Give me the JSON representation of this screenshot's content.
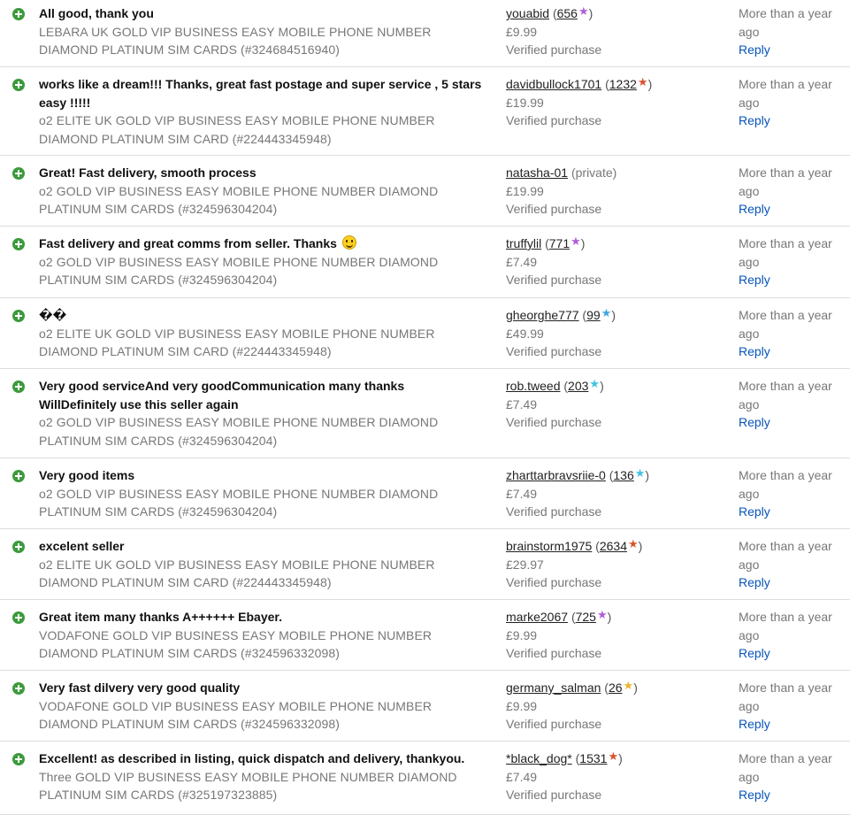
{
  "rows": [
    {
      "comment": "All good, thank you",
      "item_line1": "LEBARA UK GOLD VIP BUSINESS EASY MOBILE PHONE NUMBER",
      "item_line2": "DIAMOND PLATINUM SIM CARDS (#324684516940)",
      "user": "youabid",
      "score": "656",
      "star_color": "#b05cd6",
      "price": "£9.99",
      "verified": "Verified purchase",
      "when": "More than a year ago",
      "reply": "Reply"
    },
    {
      "comment_line1": "works like a dream!!! Thanks, great fast postage and super service , 5 stars",
      "comment_line2": "easy !!!!!",
      "item_line1": "o2 ELITE UK GOLD VIP BUSINESS EASY MOBILE PHONE NUMBER",
      "item_line2": "DIAMOND PLATINUM SIM CARD (#224443345948)",
      "user": "davidbullock1701",
      "score": "1232",
      "star_color": "#d9532c",
      "price": "£19.99",
      "verified": "Verified purchase",
      "when": "More than a year ago",
      "reply": "Reply"
    },
    {
      "comment": "Great! Fast delivery, smooth process",
      "item_line1": "o2 GOLD VIP BUSINESS EASY MOBILE PHONE NUMBER DIAMOND",
      "item_line2": "PLATINUM SIM CARDS (#324596304204)",
      "user": "natasha-01",
      "private": "(private)",
      "price": "£19.99",
      "verified": "Verified purchase",
      "when": "More than a year ago",
      "reply": "Reply"
    },
    {
      "comment": "Fast delivery and great comms from seller. Thanks",
      "item_line1": "o2 GOLD VIP BUSINESS EASY MOBILE PHONE NUMBER DIAMOND",
      "item_line2": "PLATINUM SIM CARDS (#324596304204)",
      "user": "truffylil",
      "score": "771",
      "star_color": "#b05cd6",
      "price": "£7.49",
      "verified": "Verified purchase",
      "when": "More than a year ago",
      "reply": "Reply"
    },
    {
      "comment": "��",
      "item_line1": "o2 ELITE UK GOLD VIP BUSINESS EASY MOBILE PHONE NUMBER",
      "item_line2": "DIAMOND PLATINUM SIM CARD (#224443345948)",
      "user": "gheorghe777",
      "score": "99",
      "star_color": "#3ea6e0",
      "price": "£49.99",
      "verified": "Verified purchase",
      "when": "More than a year ago",
      "reply": "Reply"
    },
    {
      "comment_line1": "Very good serviceAnd very goodCommunication many thanks",
      "comment_line2": "WillDefinitely use this seller again",
      "item_line1": "o2 GOLD VIP BUSINESS EASY MOBILE PHONE NUMBER DIAMOND",
      "item_line2": "PLATINUM SIM CARDS (#324596304204)",
      "user": "rob.tweed",
      "score": "203",
      "star_color": "#3ec3e0",
      "price": "£7.49",
      "verified": "Verified purchase",
      "when": "More than a year ago",
      "reply": "Reply"
    },
    {
      "comment": "Very good items",
      "item_line1": "o2 GOLD VIP BUSINESS EASY MOBILE PHONE NUMBER DIAMOND",
      "item_line2": "PLATINUM SIM CARDS (#324596304204)",
      "user": "zharttarbravsriie-0",
      "score": "136",
      "star_color": "#3ec3e0",
      "price": "£7.49",
      "verified": "Verified purchase",
      "when": "More than a year ago",
      "reply": "Reply"
    },
    {
      "comment": "excelent seller",
      "item_line1": "o2 ELITE UK GOLD VIP BUSINESS EASY MOBILE PHONE NUMBER",
      "item_line2": "DIAMOND PLATINUM SIM CARD (#224443345948)",
      "user": "brainstorm1975",
      "score": "2634",
      "star_color": "#d9532c",
      "price": "£29.97",
      "verified": "Verified purchase",
      "when": "More than a year ago",
      "reply": "Reply"
    },
    {
      "comment": "Great item many thanks A++++++ Ebayer.",
      "item_line1": "VODAFONE GOLD VIP BUSINESS EASY MOBILE PHONE NUMBER",
      "item_line2": "DIAMOND PLATINUM SIM CARDS (#324596332098)",
      "user": "marke2067",
      "score": "725",
      "star_color": "#b05cd6",
      "price": "£9.99",
      "verified": "Verified purchase",
      "when": "More than a year ago",
      "reply": "Reply"
    },
    {
      "comment": "Very fast dilvery very good quality",
      "item_line1": "VODAFONE GOLD VIP BUSINESS EASY MOBILE PHONE NUMBER",
      "item_line2": "DIAMOND PLATINUM SIM CARDS (#324596332098)",
      "user": "germany_salman",
      "score": "26",
      "star_color": "#e8b72c",
      "price": "£9.99",
      "verified": "Verified purchase",
      "when": "More than a year ago",
      "reply": "Reply"
    },
    {
      "comment": "Excellent! as described in listing, quick dispatch and delivery, thankyou.",
      "item_line1": "Three GOLD VIP BUSINESS EASY MOBILE PHONE NUMBER DIAMOND",
      "item_line2": "PLATINUM SIM CARDS (#325197323885)",
      "user": "*black_dog*",
      "score": "1531",
      "star_color": "#d9532c",
      "price": "£7.49",
      "verified": "Verified purchase",
      "when": "More than a year ago",
      "reply": "Reply"
    }
  ]
}
